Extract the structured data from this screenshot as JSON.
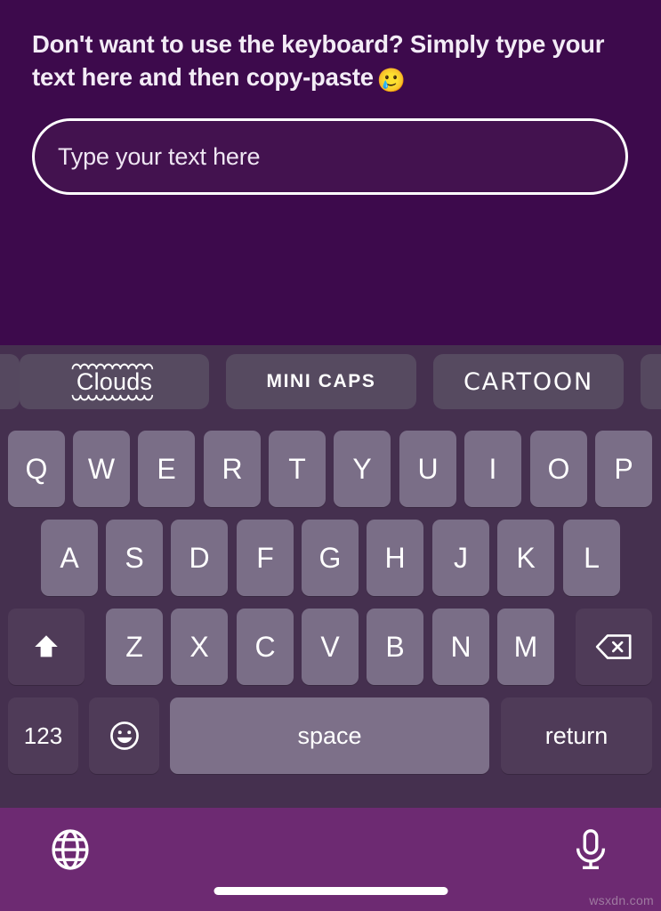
{
  "app": {
    "prompt": "Don't want to use the keyboard? Simply type your text here and then copy-paste",
    "prompt_emoji": "🥲",
    "background_color": "#3d0a4c"
  },
  "text_input": {
    "placeholder": "Type your text here",
    "value": "",
    "border_color": "#ffffff"
  },
  "keyboard": {
    "background_color": "#45304f",
    "key_color": "#7a6e87",
    "special_key_color": "#4f3b58",
    "style_chips": [
      {
        "label": "",
        "style": "edge-partial-left"
      },
      {
        "label": "Clouds",
        "style": "clouds"
      },
      {
        "label": "MINI CAPS",
        "style": "mini-caps"
      },
      {
        "label": "CARTOON",
        "style": "cartoon"
      },
      {
        "label": "",
        "style": "edge-partial-right"
      }
    ],
    "rows": {
      "row1": [
        "Q",
        "W",
        "E",
        "R",
        "T",
        "Y",
        "U",
        "I",
        "O",
        "P"
      ],
      "row2": [
        "A",
        "S",
        "D",
        "F",
        "G",
        "H",
        "J",
        "K",
        "L"
      ],
      "row3": [
        "Z",
        "X",
        "C",
        "V",
        "B",
        "N",
        "M"
      ]
    },
    "shift_key": {
      "icon": "shift-arrow-icon",
      "label": ""
    },
    "backspace_key": {
      "icon": "backspace-icon",
      "label": ""
    },
    "numbers_key": {
      "label": "123"
    },
    "emoji_key": {
      "icon": "smiley-icon",
      "label": ""
    },
    "space_key": {
      "label": "space"
    },
    "return_key": {
      "label": "return"
    }
  },
  "bottom_bar": {
    "background_color": "#6d2a72",
    "globe_icon": "globe-icon",
    "mic_icon": "microphone-icon",
    "watermark": "wsxdn.com"
  }
}
